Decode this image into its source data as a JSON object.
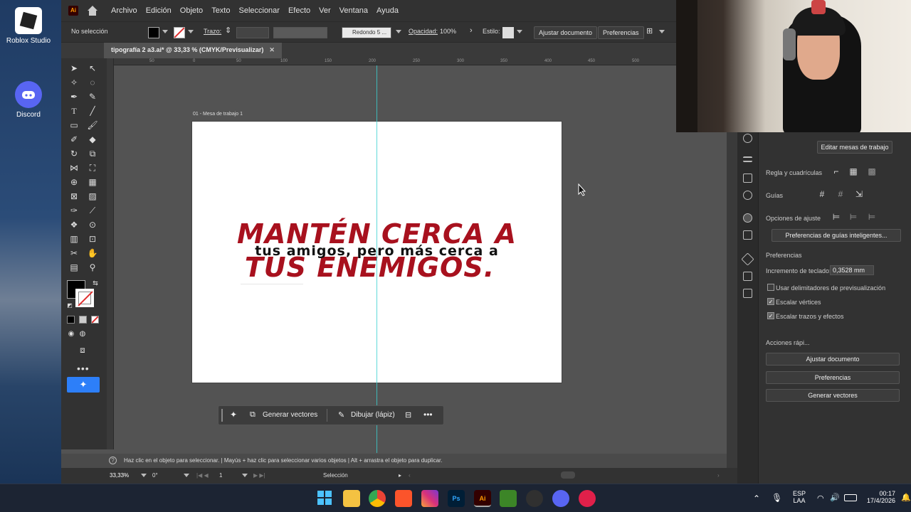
{
  "desktop": {
    "icons": [
      {
        "label": "Roblox Studio"
      },
      {
        "label": "Discord"
      }
    ]
  },
  "menubar": {
    "logo": "Ai",
    "items": [
      "Archivo",
      "Edición",
      "Objeto",
      "Texto",
      "Seleccionar",
      "Efecto",
      "Ver",
      "Ventana",
      "Ayuda"
    ]
  },
  "control_bar": {
    "selection": "No selección",
    "stroke_label": "Trazo:",
    "brush": "Redondo 5 ...",
    "opacity_label": "Opacidad:",
    "opacity_value": "100%",
    "style_label": "Estilo:",
    "fit_button": "Ajustar documento",
    "prefs_button": "Preferencias"
  },
  "document": {
    "tab_title": "tipografía 2 a3.ai* @ 33,33 % (CMYK/Previsualizar)",
    "ruler_ticks": [
      "50",
      "0",
      "50",
      "100",
      "150",
      "200",
      "250",
      "300",
      "350",
      "400",
      "450",
      "500"
    ],
    "artboard_label": "01 - Mesa de trabajo 1",
    "text_line1": "MANTÉN CERCA A",
    "text_line2": "tus amigos,  pero más cerca a",
    "text_line3": "TUS ENEMIGOS.",
    "accent_color": "#a8111e"
  },
  "context_bar": {
    "generate": "Generar vectores",
    "draw": "Dibujar (lápiz)"
  },
  "status": {
    "hint": "Haz clic en el objeto para seleccionar.  |  Mayús + haz clic para seleccionar varios objetos  |  Alt + arrastra el objeto para duplicar.",
    "zoom": "33,33%",
    "rotation": "0°",
    "artboard_num": "1",
    "tool": "Selección"
  },
  "right_panel": {
    "edit_artboards": "Editar mesas de trabajo",
    "rulers_grids": "Regla y cuadrículas",
    "guides": "Guías",
    "snap_options": "Opciones de ajuste",
    "smart_guides_prefs": "Preferencias de guías inteligentes...",
    "preferences": "Preferencias",
    "keyboard_increment_label": "Incremento de teclado:",
    "keyboard_increment_value": "0,3528 mm",
    "opt_preview_bounds": "Usar delimitadores de previsualización",
    "opt_scale_corners": "Escalar vértices",
    "opt_scale_strokes": "Escalar trazos y efectos",
    "quick_actions": "Acciones rápi...",
    "qa_fit": "Ajustar documento",
    "qa_prefs": "Preferencias",
    "qa_generate": "Generar vectores"
  },
  "taskbar": {
    "apps": [
      "Start",
      "Explorer",
      "Chrome",
      "Brave",
      "Instagram",
      "Ps",
      "Ai",
      "Minecraft",
      "OBS",
      "Discord",
      "Player"
    ],
    "language": "ESP",
    "region": "LAA",
    "time": "00:17",
    "date": "17/4/2026"
  }
}
